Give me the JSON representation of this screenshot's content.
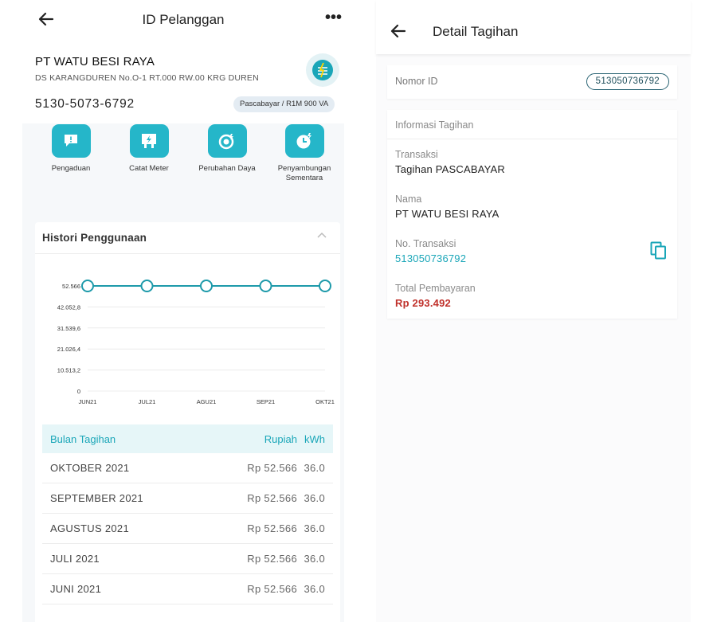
{
  "left_screen": {
    "title": "ID Pelanggan",
    "more_label": "•••",
    "customer": {
      "name": "PT WATU BESI RAYA",
      "address": "DS KARANGDUREN No.O-1 RT.000 RW.00 KRG DUREN",
      "id": "5130-5073-6792",
      "tariff": "Pascabayar / R1M 900 VA"
    },
    "menu": [
      {
        "label": "Pengaduan",
        "icon": "complaint-icon"
      },
      {
        "label": "Catat Meter",
        "icon": "meter-icon"
      },
      {
        "label": "Perubahan Daya",
        "icon": "power-change-icon"
      },
      {
        "label": "Penyambungan Sementara",
        "icon": "temporary-connection-icon"
      }
    ],
    "history": {
      "title": "Histori Penggunaan",
      "table_headers": {
        "month": "Bulan Tagihan",
        "amount": "Rupiah",
        "kwh": "kWh"
      },
      "rows": [
        {
          "month": "OKTOBER 2021",
          "amount": "Rp 52.566",
          "kwh": "36.0"
        },
        {
          "month": "SEPTEMBER 2021",
          "amount": "Rp 52.566",
          "kwh": "36.0"
        },
        {
          "month": "AGUSTUS 2021",
          "amount": "Rp 52.566",
          "kwh": "36.0"
        },
        {
          "month": "JULI 2021",
          "amount": "Rp 52.566",
          "kwh": "36.0"
        },
        {
          "month": "JUNI 2021",
          "amount": "Rp 52.566",
          "kwh": "36.0"
        }
      ]
    }
  },
  "chart_data": {
    "type": "line",
    "categories": [
      "JUN21",
      "JUL21",
      "AGU21",
      "SEP21",
      "OKT21"
    ],
    "values": [
      52566,
      52566,
      52566,
      52566,
      52566
    ],
    "y_ticks": [
      "0",
      "10.513,2",
      "21.026,4",
      "31.539,6",
      "42.052,8",
      "52.566"
    ],
    "ylim": [
      0,
      52566
    ],
    "title": "",
    "xlabel": "",
    "ylabel": "",
    "grid": true,
    "line_color": "#1e9aaa"
  },
  "right_screen": {
    "title": "Detail Tagihan",
    "id_label": "Nomor ID",
    "id_value": "513050736792",
    "info_header": "Informasi Tagihan",
    "fields": {
      "transaction_label": "Transaksi",
      "transaction_value": "Tagihan PASCABAYAR",
      "name_label": "Nama",
      "name_value": "PT WATU BESI RAYA",
      "trx_no_label": "No. Transaksi",
      "trx_no_value": "513050736792",
      "total_label": "Total Pembayaran",
      "total_value": "Rp 293.492"
    }
  },
  "colors": {
    "accent": "#25b6c9",
    "teal_text": "#1aa6b8",
    "total_red": "#c0312b"
  }
}
